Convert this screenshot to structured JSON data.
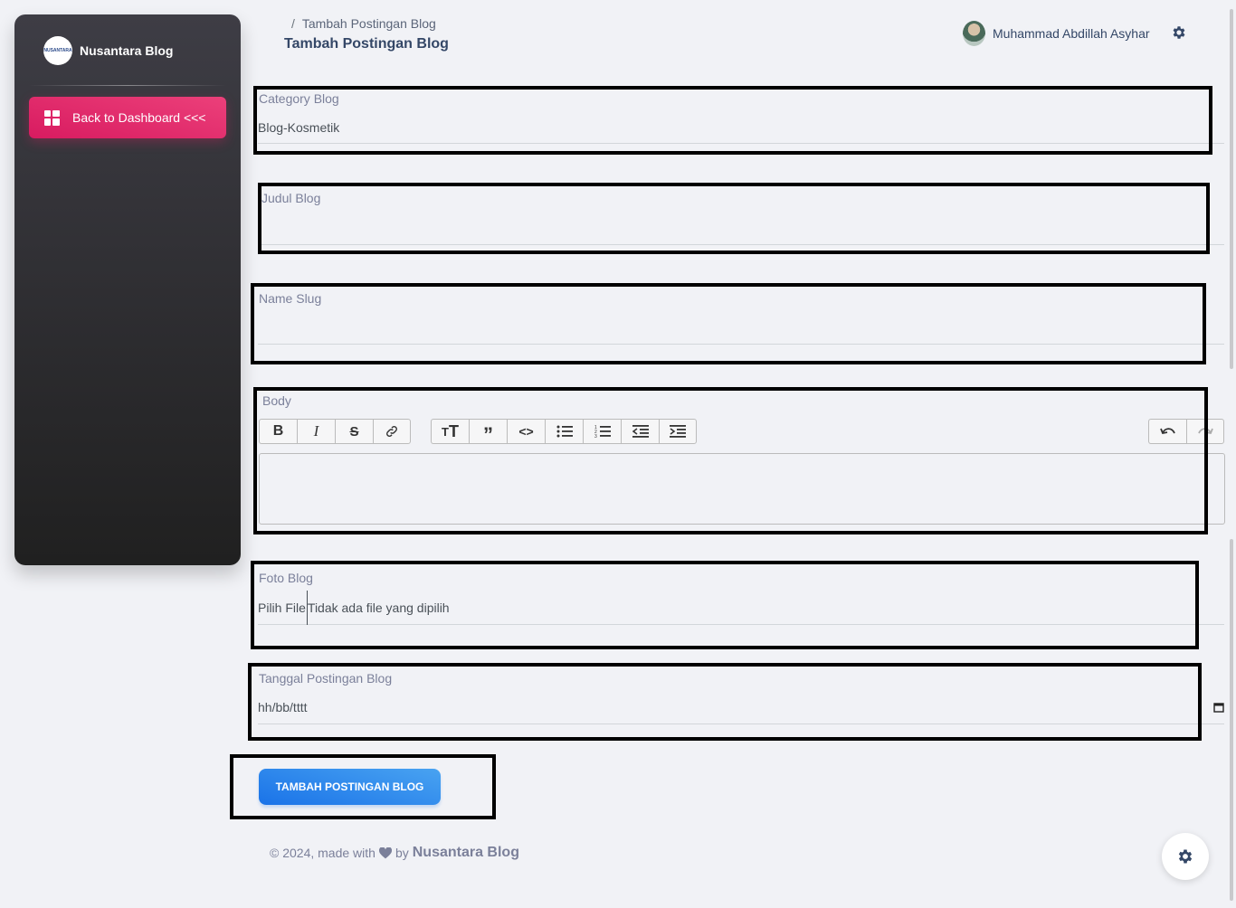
{
  "sidebar": {
    "brand_name": "Nusantara Blog",
    "logo_text": "NUSANTARA",
    "nav": [
      {
        "label": "Back to Dashboard <<<",
        "icon": "dashboard-icon"
      }
    ]
  },
  "header": {
    "breadcrumb_sep": "/",
    "breadcrumb_current": "Tambah Postingan Blog",
    "title": "Tambah Postingan Blog",
    "user_name": "Muhammad Abdillah Asyhar",
    "settings_icon": "gear-icon"
  },
  "form": {
    "category": {
      "label": "Category Blog",
      "value": "Blog-Kosmetik"
    },
    "judul": {
      "label": "Judul Blog",
      "value": ""
    },
    "slug": {
      "label": "Name Slug",
      "value": ""
    },
    "body": {
      "label": "Body"
    },
    "foto": {
      "label": "Foto Blog",
      "button_label": "Pilih File",
      "status": "Tidak ada file yang dipilih"
    },
    "tanggal": {
      "label": "Tanggal Postingan Blog",
      "placeholder": "hh/bb/tttt"
    },
    "submit_label": "TAMBAH POSTINGAN BLOG"
  },
  "toolbar": {
    "group1": [
      "bold-icon",
      "italic-icon",
      "strikethrough-icon",
      "link-icon"
    ],
    "group2": [
      "heading-icon",
      "quote-icon",
      "code-icon",
      "bullet-list-icon",
      "numbered-list-icon",
      "outdent-icon",
      "indent-icon"
    ],
    "group3": [
      "undo-icon",
      "redo-icon"
    ]
  },
  "footer": {
    "prefix": "© 2024, made with",
    "by": "by",
    "brand": "Nusantara Blog"
  },
  "colors": {
    "accent_pink": "#e91e63",
    "accent_blue": "#1a73e8",
    "sidebar_dark": "#202020"
  }
}
